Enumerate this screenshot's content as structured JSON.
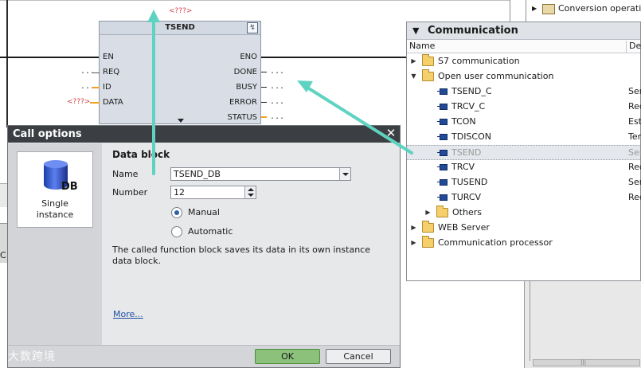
{
  "editor": {
    "block_title": "TSEND",
    "placeholder_top": "<???>",
    "placeholder_data": "<???>",
    "dots": "...",
    "pins_left": [
      "EN",
      "REQ",
      "ID",
      "DATA"
    ],
    "pins_right": [
      "ENO",
      "DONE",
      "BUSY",
      "ERROR",
      "STATUS"
    ],
    "left_cut_label": "C"
  },
  "top_strip": {
    "label": "Conversion operati"
  },
  "task_panel": {
    "title": "Communication",
    "col_name": "Name",
    "col_desc": "Des",
    "rows": [
      {
        "label": "S7 communication",
        "desc": ""
      },
      {
        "label": "Open user communication",
        "desc": ""
      },
      {
        "label": "TSEND_C",
        "desc": "Ser"
      },
      {
        "label": "TRCV_C",
        "desc": "Rec"
      },
      {
        "label": "TCON",
        "desc": "Est"
      },
      {
        "label": "TDISCON",
        "desc": "Ter"
      },
      {
        "label": "TSEND",
        "desc": "Ser"
      },
      {
        "label": "TRCV",
        "desc": "Rec"
      },
      {
        "label": "TUSEND",
        "desc": "Ser"
      },
      {
        "label": "TURCV",
        "desc": "Rec"
      },
      {
        "label": "Others",
        "desc": ""
      },
      {
        "label": "WEB Server",
        "desc": ""
      },
      {
        "label": "Communication processor",
        "desc": ""
      }
    ]
  },
  "dialog": {
    "title": "Call options",
    "instance_label_1": "Single",
    "instance_label_2": "instance",
    "db_icon_text": "DB",
    "section": "Data block",
    "name_label": "Name",
    "name_value": "TSEND_DB",
    "number_label": "Number",
    "number_value": "12",
    "radio_manual": "Manual",
    "radio_automatic": "Automatic",
    "selected_mode": "Manual",
    "description": "The called function block saves its data in its own instance data block.",
    "more_link": "More...",
    "ok": "OK",
    "cancel": "Cancel"
  },
  "watermark": "大数跨境",
  "colors": {
    "arrow": "#5fd3c1",
    "ok_button": "#8bc17a",
    "titlebar": "#3b3e43",
    "pin_orange": "#f2a21c",
    "placeholder_red": "#d2414a"
  }
}
